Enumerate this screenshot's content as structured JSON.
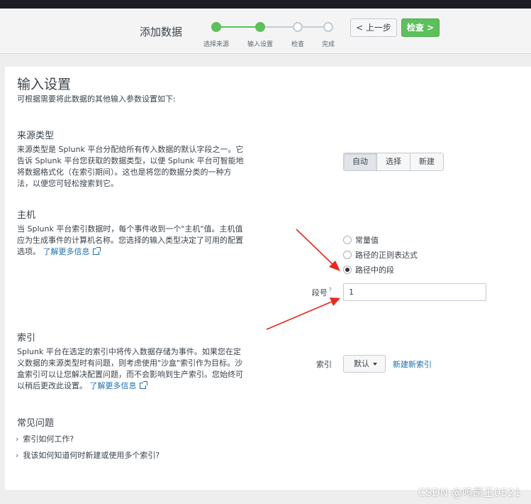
{
  "header": {
    "title": "添加数据",
    "steps": [
      {
        "label": "选择来源",
        "state": "done"
      },
      {
        "label": "输入设置",
        "state": "current"
      },
      {
        "label": "检查",
        "state": "todo"
      },
      {
        "label": "完成",
        "state": "todo"
      }
    ],
    "prev_button": "< 上一步",
    "next_button": "检查 >"
  },
  "page": {
    "title": "输入设置",
    "subtitle": "可根据需要将此数据的其他输入参数设置如下:"
  },
  "source_type": {
    "heading": "来源类型",
    "description": "来源类型是 Splunk 平台分配给所有传入数据的默认字段之一。它告诉 Splunk 平台您获取的数据类型，以便 Splunk 平台可智能地将数据格式化（在索引期间）。这也是将您的数据分类的一种方法，以便您可轻松搜索到它。",
    "options": [
      "自动",
      "选择",
      "新建"
    ],
    "selected": "自动"
  },
  "host": {
    "heading": "主机",
    "description": "当 Splunk 平台索引数据时，每个事件收到一个\"主机\"值。主机值应为生成事件的计算机名称。您选择的输入类型决定了可用的配置选项。",
    "learn_more": "了解更多信息",
    "radio_options": [
      "常量值",
      "路径的正则表达式",
      "路径中的段"
    ],
    "selected": "路径中的段",
    "segment_label": "段号",
    "segment_help": "?",
    "segment_value": "1"
  },
  "index": {
    "heading": "索引",
    "description": "Splunk 平台在选定的索引中将传入数据存储为事件。如果您在定义数据的来源类型时有问题，则考虑使用\"沙盒\"索引作为目标。沙盒索引可以让您解决配置问题，而不会影响到生产索引。您始终可以稍后更改此设置。",
    "learn_more": "了解更多信息",
    "field_label": "索引",
    "dropdown_value": "默认",
    "new_index_link": "新建新索引"
  },
  "faq": {
    "heading": "常见问题",
    "items": [
      "索引如何工作?",
      "我该如何知道何时新建或使用多个索引?"
    ]
  },
  "watermark": "CSDN @呜昂王0521",
  "colors": {
    "accent_green": "#5cc05c",
    "link_blue": "#1a6faf",
    "annotation_red": "#e8281e"
  }
}
